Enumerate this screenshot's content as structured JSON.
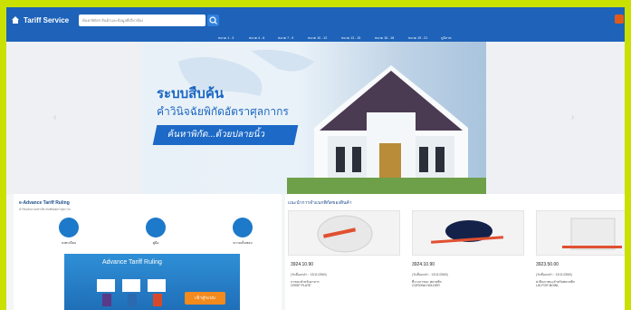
{
  "header": {
    "brand": "Tariff Service",
    "search_placeholder": "ค้นหาพิกัดฯ สินค้าและข้อมูลที่เกี่ยวข้อง"
  },
  "nav": [
    "หมวด 1 - 3",
    "หมวด 4 - 6",
    "หมวด 7 - 9",
    "หมวด 10 - 12",
    "หมวด 13 - 15",
    "หมวด 16 - 18",
    "หมวด 19 - 21",
    "ภูมิภาค"
  ],
  "banner": {
    "title": "ระบบสืบค้น",
    "subtitle": "คำวินิจฉัยพิกัดอัตราศุลกากร",
    "tagline": "ค้นหาพิกัด...ด้วยปลายนิ้ว"
  },
  "left": {
    "title": "e-Advance Tariff Ruling",
    "desc": "คำวินิจฉัยล่วงหน้าเกี่ยวกับพิกัดอัตราศุลกากร",
    "icons": [
      {
        "label": "ลงทะเบียน",
        "icon": "document-icon"
      },
      {
        "label": "คู่มือ",
        "icon": "book-icon"
      },
      {
        "label": "ความเห็นชอบ",
        "icon": "check-icon"
      }
    ],
    "promo_title": "Advance Tariff Ruling",
    "promo_button": "เข้าสู่ระบบ"
  },
  "right": {
    "title": "แนะนำการจำแนกพิกัดของสินค้า",
    "cards": [
      {
        "code": "3924.10.90",
        "date": "(วันที่ออกคำ : 13/11/2560)",
        "th": "ภาชนะสำหรับอาหาร",
        "en": "CRISP PLATE"
      },
      {
        "code": "3924.10.90",
        "date": "(วันที่ออกคำ : 13/11/2560)",
        "th": "ที่วางภาชนะ พลาสติก",
        "en": "CORONA HOLDER"
      },
      {
        "code": "3923.50.00",
        "date": "(วันที่ออกคำ : 13/11/2560)",
        "th": "ฝาปิดภาชนะสำหรับพลาสติก",
        "en": "LID FOR BOWL"
      }
    ]
  },
  "colors": {
    "primary": "#1e63b9",
    "accent": "#f38a1e",
    "frame": "#c9e000"
  }
}
